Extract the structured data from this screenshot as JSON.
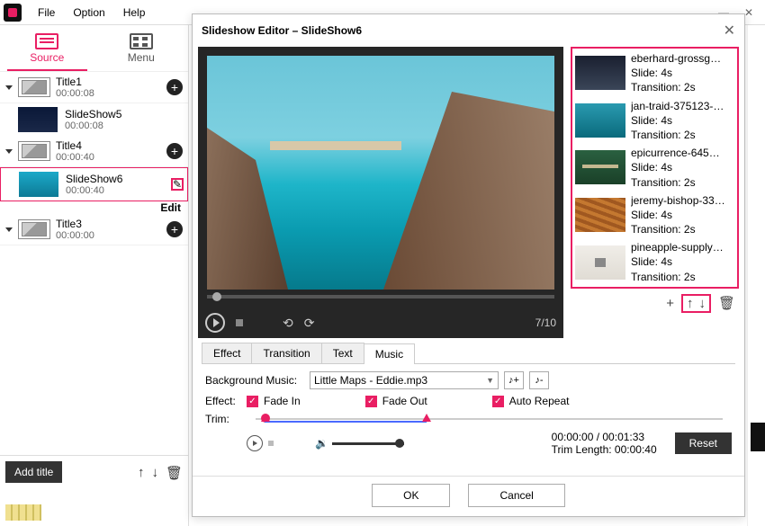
{
  "menubar": {
    "items": [
      "File",
      "Option",
      "Help"
    ]
  },
  "left": {
    "tabs": {
      "source": "Source",
      "menu": "Menu"
    },
    "titles": [
      {
        "name": "Title1",
        "time": "00:00:08",
        "child": {
          "name": "SlideShow5",
          "time": "00:00:08",
          "thumb": "night"
        }
      },
      {
        "name": "Title4",
        "time": "00:00:40",
        "child": {
          "name": "SlideShow6",
          "time": "00:00:40",
          "thumb": "beach",
          "selected": true,
          "editable": true
        }
      },
      {
        "name": "Title3",
        "time": "00:00:00"
      }
    ],
    "edit_label": "Edit",
    "add_title": "Add title"
  },
  "modal": {
    "title": "Slideshow Editor   –   SlideShow6",
    "counter": "7/10",
    "slides": [
      {
        "name": "eberhard-grossgast...",
        "slide": "Slide: 4s",
        "trans": "Transition: 2s",
        "th": "th1"
      },
      {
        "name": "jan-traid-375123-u...",
        "slide": "Slide: 4s",
        "trans": "Transition: 2s",
        "th": "th2"
      },
      {
        "name": "epicurrence-64531-...",
        "slide": "Slide: 4s",
        "trans": "Transition: 2s",
        "th": "th3"
      },
      {
        "name": "jeremy-bishop-3376...",
        "slide": "Slide: 4s",
        "trans": "Transition: 2s",
        "th": "th4"
      },
      {
        "name": "pineapple-supply-co...",
        "slide": "Slide: 4s",
        "trans": "Transition: 2s",
        "th": "th5"
      }
    ],
    "tabs": {
      "effect": "Effect",
      "transition": "Transition",
      "text": "Text",
      "music": "Music"
    },
    "music": {
      "bg_label": "Background Music:",
      "bg_value": "Little Maps - Eddie.mp3",
      "effect_label": "Effect:",
      "fade_in": "Fade In",
      "fade_out": "Fade Out",
      "auto_repeat": "Auto Repeat",
      "trim_label": "Trim:",
      "time": "00:00:00 / 00:01:33",
      "trim_len": "Trim Length: 00:00:40",
      "reset": "Reset"
    },
    "ok": "OK",
    "cancel": "Cancel"
  }
}
